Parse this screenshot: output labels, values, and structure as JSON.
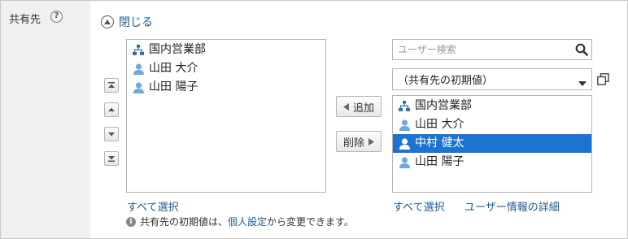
{
  "field": {
    "label": "共有先",
    "help_icon": "question-circle-icon"
  },
  "toggle": {
    "label": "閉じる",
    "icon": "chevron-up-circle-icon"
  },
  "left_list": {
    "items": [
      {
        "type": "org",
        "label": "国内営業部"
      },
      {
        "type": "user",
        "label": "山田 大介"
      },
      {
        "type": "user",
        "label": "山田 陽子"
      }
    ],
    "select_all": "すべて選択"
  },
  "sort_buttons": [
    "move-top",
    "move-up",
    "move-down",
    "move-bottom"
  ],
  "middle": {
    "add_label": "追加",
    "remove_label": "削除"
  },
  "right": {
    "search_placeholder": "ユーザー検索",
    "dropdown_value": "（共有先の初期値）",
    "items": [
      {
        "type": "org",
        "label": "国内営業部",
        "selected": false
      },
      {
        "type": "user",
        "label": "山田 大介",
        "selected": false
      },
      {
        "type": "user",
        "label": "中村 健太",
        "selected": true
      },
      {
        "type": "user",
        "label": "山田 陽子",
        "selected": false
      }
    ],
    "select_all": "すべて選択",
    "user_details": "ユーザー情報の詳細"
  },
  "note": {
    "prefix": "共有先の初期値は、",
    "link": "個人設定",
    "suffix": "から変更できます。"
  },
  "colors": {
    "selected_bg": "#1c74d0",
    "link": "#1e5a8f",
    "user_icon": "#6fa8dc",
    "org_icon": "#2e6da4",
    "label_bg": "#f0f0f0"
  }
}
